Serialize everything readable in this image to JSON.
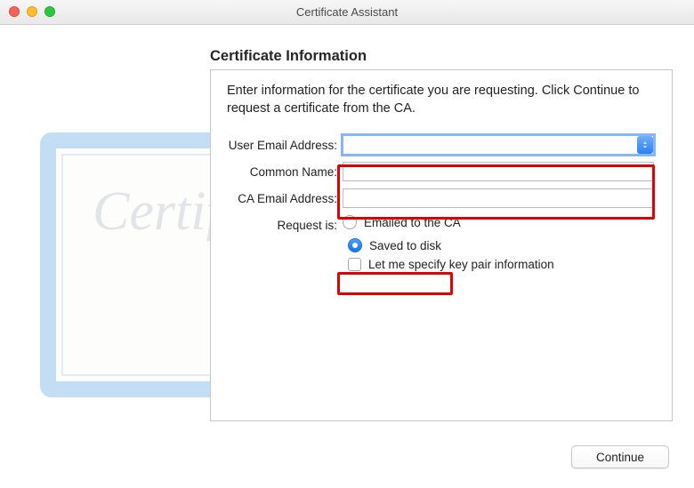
{
  "window": {
    "title": "Certificate Assistant"
  },
  "heading": "Certificate Information",
  "instructions": "Enter information for the certificate you are requesting. Click Continue to request a certificate from the CA.",
  "form": {
    "user_email_label": "User Email Address:",
    "user_email_value": "",
    "common_name_label": "Common Name:",
    "common_name_value": "",
    "ca_email_label": "CA Email Address:",
    "ca_email_value": "",
    "request_label": "Request is:",
    "option_emailed": "Emailed to the CA",
    "option_saved": "Saved to disk",
    "selected_option": "saved",
    "spec_keypair_label": "Let me specify key pair information",
    "spec_keypair_checked": false
  },
  "buttons": {
    "continue": "Continue"
  }
}
